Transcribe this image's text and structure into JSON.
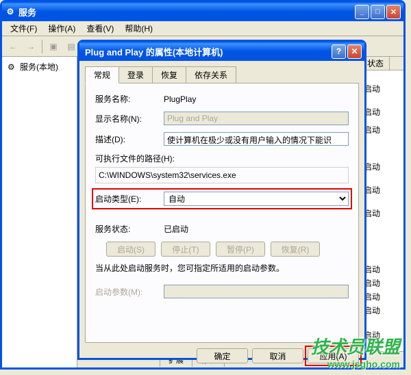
{
  "main": {
    "title": "服务",
    "menu": {
      "file": "文件(F)",
      "action": "操作(A)",
      "view": "查看(V)",
      "help": "帮助(H)"
    },
    "tree": {
      "root": "服务(本地)"
    },
    "list": {
      "header_status": "状态",
      "status_started": "已启动"
    },
    "tabs": {
      "extended": "扩展",
      "standard": "标准"
    }
  },
  "dialog": {
    "title": "Plug and Play 的属性(本地计算机)",
    "tabs": {
      "general": "常规",
      "logon": "登录",
      "recovery": "恢复",
      "dependencies": "依存关系"
    },
    "labels": {
      "service_name": "服务名称:",
      "display_name": "显示名称(N):",
      "description": "描述(D):",
      "executable_path": "可执行文件的路径(H):",
      "startup_type": "启动类型(E):",
      "service_status": "服务状态:",
      "startup_params": "启动参数(M):"
    },
    "values": {
      "service_name": "PlugPlay",
      "display_name": "Plug and Play",
      "description": "使计算机在极少或没有用户输入的情况下能识",
      "executable_path": "C:\\WINDOWS\\system32\\services.exe",
      "startup_type": "自动",
      "service_status": "已启动",
      "startup_params": ""
    },
    "buttons": {
      "start": "启动(S)",
      "stop": "停止(T)",
      "pause": "暂停(P)",
      "resume": "恢复(R)",
      "ok": "确定",
      "cancel": "取消",
      "apply": "应用(A)"
    },
    "help_text": "当从此处启动服务时，您可指定所适用的启动参数。"
  },
  "watermark": {
    "text": "技术员联盟",
    "url": "www.jsgho.com"
  }
}
